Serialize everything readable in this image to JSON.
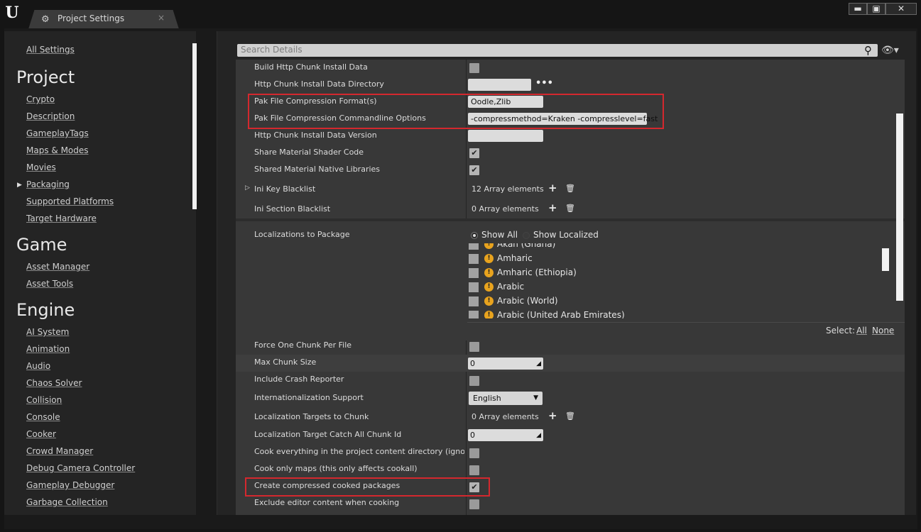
{
  "window": {
    "tab_title": "Project Settings",
    "tab_close": "×",
    "minimize": "▬",
    "maximize": "▣",
    "close": "✕"
  },
  "nav": {
    "all_settings": "All Settings",
    "sections": [
      {
        "header": "Project",
        "items": [
          "Crypto",
          "Description",
          "GameplayTags",
          "Maps & Modes",
          "Movies",
          "Packaging",
          "Supported Platforms",
          "Target Hardware"
        ]
      },
      {
        "header": "Game",
        "items": [
          "Asset Manager",
          "Asset Tools"
        ]
      },
      {
        "header": "Engine",
        "items": [
          "AI System",
          "Animation",
          "Audio",
          "Chaos Solver",
          "Collision",
          "Console",
          "Cooker",
          "Crowd Manager",
          "Debug Camera Controller",
          "Gameplay Debugger",
          "Garbage Collection"
        ]
      }
    ],
    "selected": "Packaging"
  },
  "search": {
    "placeholder": "Search Details"
  },
  "rows": {
    "build_http": {
      "label": "Build Http Chunk Install Data",
      "checked": false
    },
    "http_dir": {
      "label": "Http Chunk Install Data Directory",
      "value": ""
    },
    "pak_format": {
      "label": "Pak File Compression Format(s)",
      "value": "Oodle,Zlib"
    },
    "pak_options": {
      "label": "Pak File Compression Commandline Options",
      "value": "-compressmethod=Kraken -compresslevel=fast"
    },
    "http_version": {
      "label": "Http Chunk Install Data Version",
      "value": ""
    },
    "share_shader": {
      "label": "Share Material Shader Code",
      "checked": true
    },
    "shared_native": {
      "label": "Shared Material Native Libraries",
      "checked": true
    },
    "ini_key": {
      "label": "Ini Key Blacklist",
      "value": "12 Array elements"
    },
    "ini_section": {
      "label": "Ini Section Blacklist",
      "value": "0 Array elements"
    },
    "localizations": {
      "label": "Localizations to Package"
    },
    "force_chunk": {
      "label": "Force One Chunk Per File",
      "checked": false
    },
    "max_chunk": {
      "label": "Max Chunk Size",
      "value": "0"
    },
    "crash_reporter": {
      "label": "Include Crash Reporter",
      "checked": false
    },
    "i18n": {
      "label": "Internationalization Support",
      "value": "English"
    },
    "loc_targets": {
      "label": "Localization Targets to Chunk",
      "value": "0 Array elements"
    },
    "loc_catch": {
      "label": "Localization Target Catch All Chunk Id",
      "value": "0"
    },
    "cook_everything": {
      "label": "Cook everything in the project content directory (ignore list",
      "checked": false
    },
    "cook_maps": {
      "label": "Cook only maps (this only affects cookall)",
      "checked": false
    },
    "compressed": {
      "label": "Create compressed cooked packages",
      "checked": true
    },
    "exclude_editor": {
      "label": "Exclude editor content when cooking",
      "checked": false
    }
  },
  "localization": {
    "show_all": "Show All",
    "show_localized": "Show Localized",
    "languages": [
      "Akan (Ghana)",
      "Amharic",
      "Amharic (Ethiopia)",
      "Arabic",
      "Arabic (World)",
      "Arabic (United Arab Emirates)"
    ],
    "select_label": "Select:",
    "select_all": "All",
    "select_none": "None"
  },
  "colors": {
    "highlight_box": "#d4282e",
    "warning": "#e8a31e"
  }
}
